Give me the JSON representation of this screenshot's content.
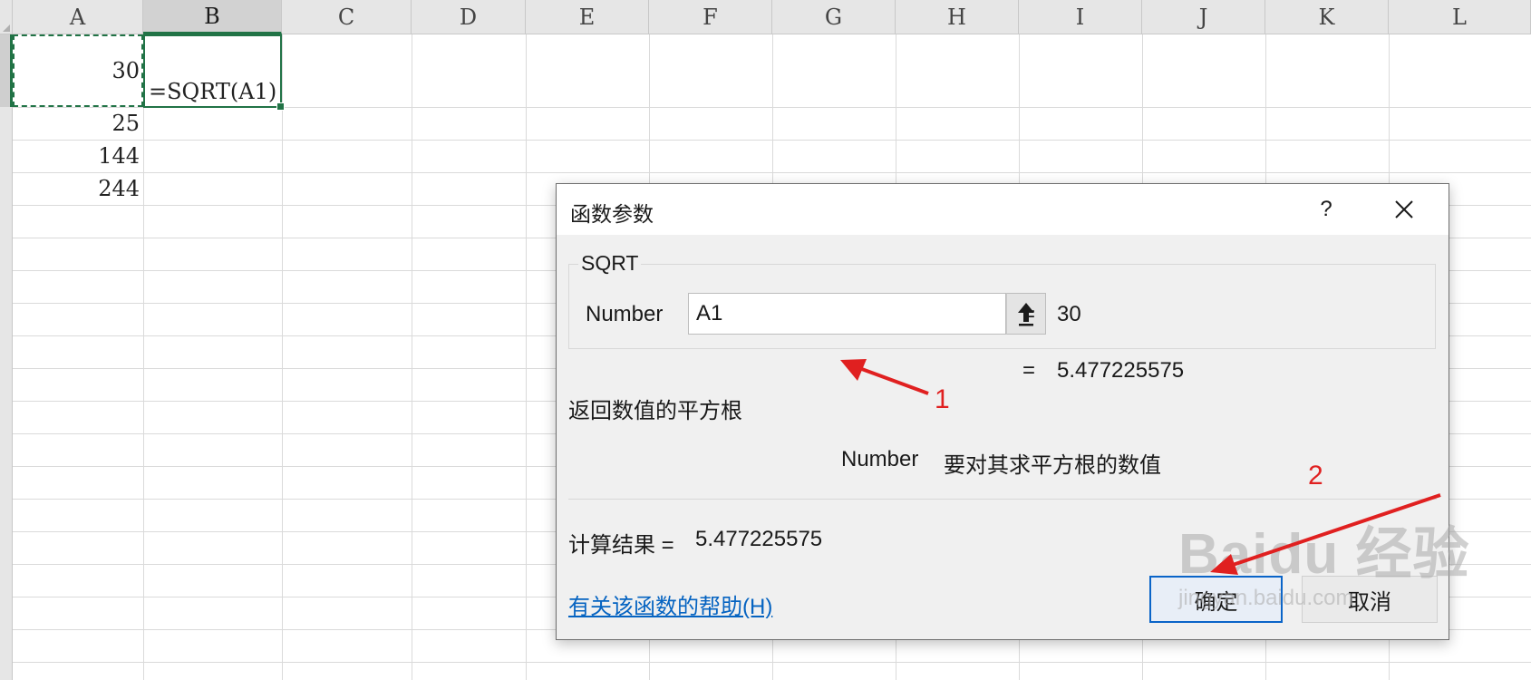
{
  "sheet": {
    "columns": [
      "A",
      "B",
      "C",
      "D",
      "E",
      "F",
      "G",
      "H",
      "I",
      "J",
      "K",
      "L"
    ],
    "active_column": "B",
    "cells": {
      "A1": "30",
      "A2": "25",
      "A3": "144",
      "A4": "244",
      "B1": "=SQRT(A1)"
    }
  },
  "dialog": {
    "title": "函数参数",
    "help_button": "?",
    "function_name": "SQRT",
    "argument_label": "Number",
    "argument_value": "A1",
    "equals": "=",
    "argument_result": "30",
    "formula_preview": "5.477225575",
    "description": "返回数值的平方根",
    "argument_desc_name": "Number",
    "argument_desc_text": "要对其求平方根的数值",
    "result_label": "计算结果 =",
    "result_value": "5.477225575",
    "help_link": "有关该函数的帮助(H)",
    "ok_label": "确定",
    "cancel_label": "取消"
  },
  "annotations": {
    "label_1": "1",
    "label_2": "2",
    "color": "#e02020"
  },
  "watermark": {
    "main": "Baidu 经验",
    "sub": "jingyan.baidu.com"
  },
  "colors": {
    "excel_green": "#217346",
    "link_blue": "#0563c1",
    "ok_border": "#0a64c8"
  }
}
